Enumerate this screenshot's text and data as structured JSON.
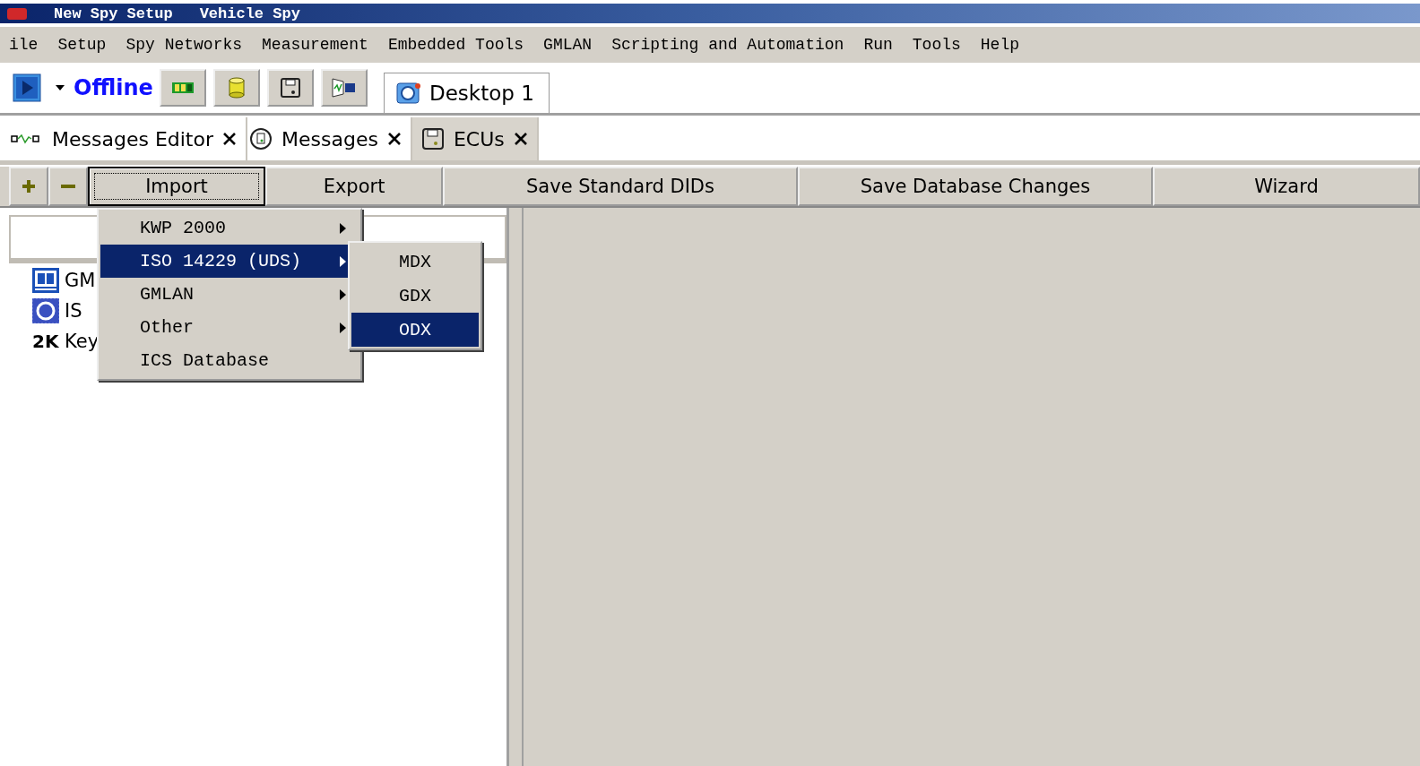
{
  "window": {
    "title_parts": [
      "New Spy Setup",
      "Vehicle Spy"
    ]
  },
  "menu_bar": [
    {
      "label": "ile"
    },
    {
      "label": "Setup"
    },
    {
      "label": "Spy Networks"
    },
    {
      "label": "Measurement"
    },
    {
      "label": "Embedded Tools"
    },
    {
      "label": "GMLAN"
    },
    {
      "label": "Scripting and Automation"
    },
    {
      "label": "Run"
    },
    {
      "label": "Tools"
    },
    {
      "label": "Help"
    }
  ],
  "toolbar": {
    "status": "Offline",
    "desktop_tab": "Desktop 1"
  },
  "tabs": [
    {
      "label": "Messages Editor",
      "selected": false,
      "kind": "wave"
    },
    {
      "label": "Messages",
      "selected": false,
      "kind": "clock"
    },
    {
      "label": "ECUs",
      "selected": true,
      "kind": "disk"
    }
  ],
  "action_buttons": [
    {
      "label": "Import",
      "focused": true
    },
    {
      "label": "Export",
      "focused": false
    },
    {
      "label": "Save Standard DIDs",
      "focused": false
    },
    {
      "label": "Save Database Changes",
      "focused": false
    },
    {
      "label": "Wizard",
      "focused": false
    }
  ],
  "tree": [
    {
      "kind": "gm",
      "label": "GM"
    },
    {
      "kind": "iso",
      "label": "IS"
    },
    {
      "kind": "key",
      "icon_text": "2K",
      "label": "Key"
    }
  ],
  "import_menu": [
    {
      "label": "KWP 2000",
      "has_submenu": true,
      "selected": false
    },
    {
      "label": "ISO 14229 (UDS)",
      "has_submenu": true,
      "selected": true
    },
    {
      "label": "GMLAN",
      "has_submenu": true,
      "selected": false
    },
    {
      "label": "Other",
      "has_submenu": true,
      "selected": false
    },
    {
      "label": "ICS Database",
      "has_submenu": false,
      "selected": false
    }
  ],
  "submenu": [
    {
      "label": "MDX",
      "selected": false
    },
    {
      "label": "GDX",
      "selected": false
    },
    {
      "label": "ODX",
      "selected": true
    }
  ]
}
